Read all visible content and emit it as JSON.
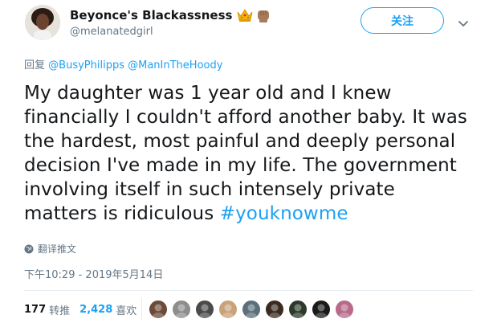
{
  "author": {
    "display_name": "Beyonce's Blackassness",
    "emoji": [
      "crown-emoji",
      "raised-fist-emoji"
    ],
    "handle": "@melanatedgirl",
    "follow_label": "关注"
  },
  "reply": {
    "prefix": "回复",
    "mentions": [
      "@BusyPhilipps",
      "@ManInTheHoody"
    ]
  },
  "tweet": {
    "text": "My daughter was 1 year old and I knew financially I couldn't afford another baby. It was the hardest, most painful and deeply personal decision I've made in my life. The government involving itself in such intensely private matters is ridiculous ",
    "hashtag": "#youknowme"
  },
  "translate": {
    "label": "翻译推文",
    "icon": "globe-icon"
  },
  "timestamp": "下午10:29 - 2019年5月14日",
  "stats": {
    "retweets": "177",
    "retweets_label": "转推",
    "likes": "2,428",
    "likes_label": "喜欢"
  },
  "likers": [
    {
      "name": "liker-avatar-1",
      "color": "#6b4a3a"
    },
    {
      "name": "liker-avatar-2",
      "color": "#8d8d8d"
    },
    {
      "name": "liker-avatar-3",
      "color": "#4a4a4a"
    },
    {
      "name": "liker-avatar-4",
      "color": "#c9a27a"
    },
    {
      "name": "liker-avatar-5",
      "color": "#5a6f7a"
    },
    {
      "name": "liker-avatar-6",
      "color": "#3a2a1f"
    },
    {
      "name": "liker-avatar-7",
      "color": "#2c3a2a"
    },
    {
      "name": "liker-avatar-8",
      "color": "#1a1a1a"
    },
    {
      "name": "liker-avatar-9",
      "color": "#b86a88"
    }
  ],
  "colors": {
    "accent": "#1da1f2",
    "secondary_text": "#657786",
    "primary_text": "#14171a",
    "divider": "#e6ecf0"
  }
}
